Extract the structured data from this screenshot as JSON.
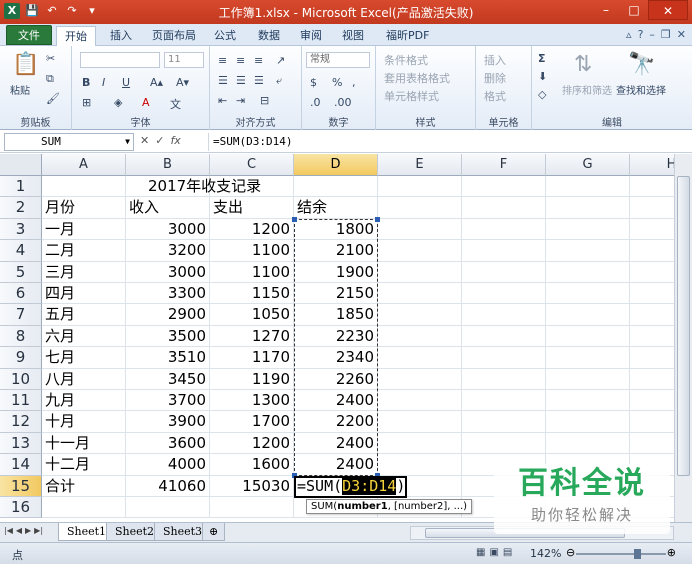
{
  "window": {
    "title": "工作簿1.xlsx - Microsoft Excel(产品激活失败)",
    "controls": {
      "minimize": "–",
      "maximize": "□",
      "close": "✕"
    }
  },
  "tabs": [
    {
      "label": "文件"
    },
    {
      "label": "开始"
    },
    {
      "label": "插入"
    },
    {
      "label": "页面布局"
    },
    {
      "label": "公式"
    },
    {
      "label": "数据"
    },
    {
      "label": "审阅"
    },
    {
      "label": "视图"
    },
    {
      "label": "福昕PDF"
    }
  ],
  "ribbon": {
    "clipboard": {
      "label": "剪贴板",
      "paste": "粘贴"
    },
    "font": {
      "label": "字体",
      "size": "11"
    },
    "alignment": {
      "label": "对齐方式"
    },
    "number": {
      "label": "数字",
      "format": "常规"
    },
    "styles": {
      "label": "样式",
      "conditional": "条件格式",
      "table": "套用表格格式",
      "cell": "单元格样式"
    },
    "cells": {
      "label": "单元格",
      "insert": "插入",
      "delete": "删除",
      "format": "格式"
    },
    "editing": {
      "label": "编辑",
      "sort": "排序和筛选",
      "find": "查找和选择"
    }
  },
  "formula_bar": {
    "name_box": "SUM",
    "formula": "=SUM(D3:D14)"
  },
  "columns": [
    "A",
    "B",
    "C",
    "D",
    "E",
    "F",
    "G",
    "H"
  ],
  "rows": [
    {
      "n": "1",
      "a": "",
      "title": "2017年收支记录"
    },
    {
      "n": "2",
      "a": "月份",
      "b": "收入",
      "c": "支出",
      "d": "结余"
    },
    {
      "n": "3",
      "a": "一月",
      "b": "3000",
      "c": "1200",
      "d": "1800"
    },
    {
      "n": "4",
      "a": "二月",
      "b": "3200",
      "c": "1100",
      "d": "2100"
    },
    {
      "n": "5",
      "a": "三月",
      "b": "3000",
      "c": "1100",
      "d": "1900"
    },
    {
      "n": "6",
      "a": "四月",
      "b": "3300",
      "c": "1150",
      "d": "2150"
    },
    {
      "n": "7",
      "a": "五月",
      "b": "2900",
      "c": "1050",
      "d": "1850"
    },
    {
      "n": "8",
      "a": "六月",
      "b": "3500",
      "c": "1270",
      "d": "2230"
    },
    {
      "n": "9",
      "a": "七月",
      "b": "3510",
      "c": "1170",
      "d": "2340"
    },
    {
      "n": "10",
      "a": "八月",
      "b": "3450",
      "c": "1190",
      "d": "2260"
    },
    {
      "n": "11",
      "a": "九月",
      "b": "3700",
      "c": "1300",
      "d": "2400"
    },
    {
      "n": "12",
      "a": "十月",
      "b": "3900",
      "c": "1700",
      "d": "2200"
    },
    {
      "n": "13",
      "a": "十一月",
      "b": "3600",
      "c": "1200",
      "d": "2400"
    },
    {
      "n": "14",
      "a": "十二月",
      "b": "4000",
      "c": "1600",
      "d": "2400"
    },
    {
      "n": "15",
      "a": "合计",
      "b": "41060",
      "c": "15030"
    },
    {
      "n": "16",
      "a": ""
    }
  ],
  "edit_cell": {
    "prefix": "=SUM(",
    "range": "D3:D14",
    "suffix": ")"
  },
  "tooltip": {
    "fn": "SUM(",
    "arg1": "number1",
    "rest": ", [number2], ...)"
  },
  "sheets": [
    "Sheet1",
    "Sheet2",
    "Sheet3"
  ],
  "status": {
    "mode": "点",
    "zoom": "142%"
  },
  "watermark": {
    "main": "百科全说",
    "sub": "助你轻松解决"
  },
  "colors": {
    "title_bar": "#c2391f",
    "file_tab": "#2a7a3b",
    "selection_header": "#f2c960",
    "watermark_green": "#27a85a"
  }
}
